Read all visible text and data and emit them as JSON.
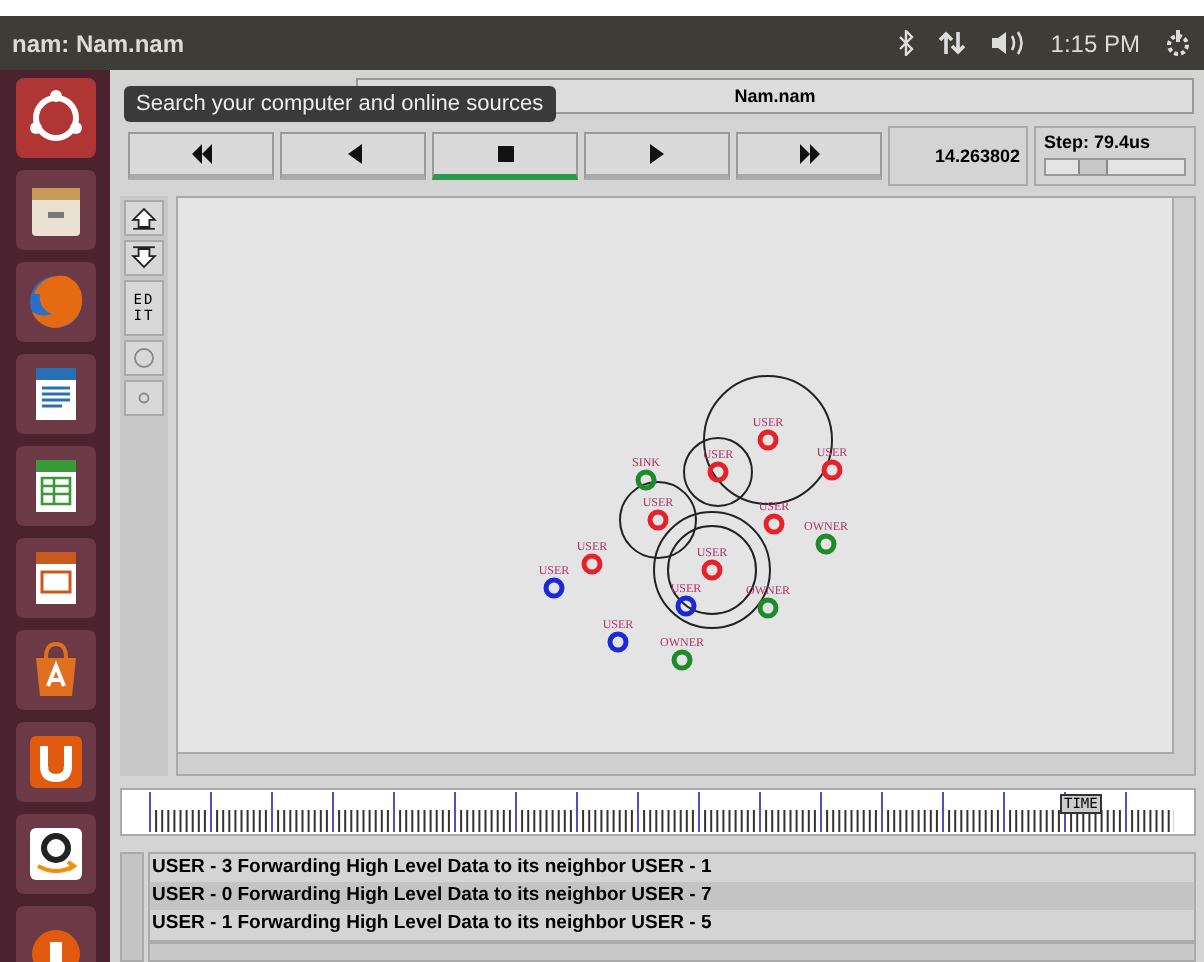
{
  "top_bar": {
    "title": "nam: Nam.nam",
    "clock": "1:15 PM"
  },
  "launcher": {
    "items": [
      {
        "kind": "ubuntu",
        "selected": true
      },
      {
        "kind": "files",
        "selected": false
      },
      {
        "kind": "browser",
        "selected": false
      },
      {
        "kind": "writer",
        "selected": false
      },
      {
        "kind": "calc",
        "selected": false
      },
      {
        "kind": "impress",
        "selected": false
      },
      {
        "kind": "store",
        "selected": false
      },
      {
        "kind": "u",
        "selected": false
      },
      {
        "kind": "amazon",
        "selected": false
      },
      {
        "kind": "partial",
        "selected": false
      }
    ]
  },
  "tooltip": "Search your computer and online sources",
  "file_field": "Nam.nam",
  "controls": [
    {
      "kind": "rewind",
      "selected": false
    },
    {
      "kind": "back",
      "selected": false
    },
    {
      "kind": "stop",
      "selected": true
    },
    {
      "kind": "play",
      "selected": false
    },
    {
      "kind": "forward",
      "selected": false
    }
  ],
  "time": "14.263802",
  "step": {
    "label": "Step: 79.4us",
    "level": 0.3
  },
  "tools": [
    {
      "kind": "zoom-in"
    },
    {
      "kind": "zoom-out"
    },
    {
      "kind": "edit",
      "label": "ED IT"
    },
    {
      "kind": "circle"
    },
    {
      "kind": "dot"
    }
  ],
  "nodes": [
    {
      "label": "USER",
      "color": "#e8202a"
    },
    {
      "label": "USER",
      "color": "#e8202a"
    },
    {
      "label": "USER",
      "color": "#e8202a"
    },
    {
      "label": "SINK",
      "color": "#1e8a2a"
    },
    {
      "label": "USER",
      "color": "#e8202a"
    },
    {
      "label": "USER",
      "color": "#e8202a"
    },
    {
      "label": "OWNER",
      "color": "#1e8a2a"
    },
    {
      "label": "USER",
      "color": "#e8202a"
    },
    {
      "label": "USER",
      "color": "#e8202a"
    },
    {
      "label": "USER",
      "color": "#1a28d8"
    },
    {
      "label": "USER",
      "color": "#1a28d8"
    },
    {
      "label": "OWNER",
      "color": "#1e8a2a"
    },
    {
      "label": "USER",
      "color": "#1a28d8"
    },
    {
      "label": "OWNER",
      "color": "#1e8a2a"
    }
  ],
  "timeline": {
    "marker": "TIME",
    "level": 0.875
  },
  "log": [
    {
      "text": "USER - 3 Forwarding High Level Data to its neighbor USER - 1",
      "selected": false
    },
    {
      "text": "USER - 0 Forwarding High Level Data to its neighbor USER - 7",
      "selected": true
    },
    {
      "text": "USER - 1 Forwarding High Level Data to its neighbor USER - 5",
      "selected": false
    }
  ]
}
